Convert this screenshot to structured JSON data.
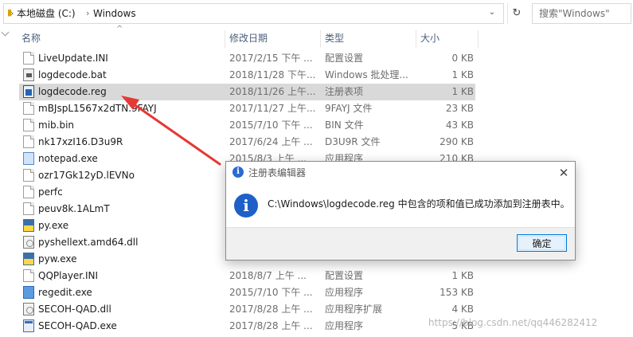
{
  "address_bar": {
    "breadcrumbs": [
      "本地磁盘 (C:)",
      "Windows"
    ],
    "search_placeholder": "搜索\"Windows\""
  },
  "columns": [
    "名称",
    "修改日期",
    "类型",
    "大小"
  ],
  "files": [
    {
      "name": "LiveUpdate.INI",
      "date": "2017/2/15 下午 ...",
      "type": "配置设置",
      "size": "0 KB",
      "icon": "ini-file-icon"
    },
    {
      "name": "logdecode.bat",
      "date": "2018/11/28 下午...",
      "type": "Windows 批处理...",
      "size": "1 KB",
      "icon": "bat-file-icon"
    },
    {
      "name": "logdecode.reg",
      "date": "2018/11/26 上午...",
      "type": "注册表项",
      "size": "1 KB",
      "icon": "reg-file-icon",
      "selected": true
    },
    {
      "name": "mBJspL1567x2dTN.9FAYJ",
      "date": "2017/11/27 上午...",
      "type": "9FAYJ 文件",
      "size": "23 KB",
      "icon": "generic-file-icon"
    },
    {
      "name": "mib.bin",
      "date": "2015/7/10 下午 ...",
      "type": "BIN 文件",
      "size": "43 KB",
      "icon": "generic-file-icon"
    },
    {
      "name": "nk17xzI16.D3u9R",
      "date": "2017/6/24 上午 ...",
      "type": "D3U9R 文件",
      "size": "290 KB",
      "icon": "generic-file-icon"
    },
    {
      "name": "notepad.exe",
      "date": "2015/8/3 上午 ...",
      "type": "应用程序",
      "size": "210 KB",
      "icon": "notepad-icon"
    },
    {
      "name": "ozr17Gk12yD.lEVNo",
      "date": "",
      "type": "",
      "size": "",
      "icon": "generic-file-icon"
    },
    {
      "name": "perfc",
      "date": "",
      "type": "",
      "size": "",
      "icon": "generic-file-icon"
    },
    {
      "name": "peuv8k.1ALmT",
      "date": "",
      "type": "",
      "size": "",
      "icon": "generic-file-icon"
    },
    {
      "name": "py.exe",
      "date": "",
      "type": "",
      "size": "",
      "icon": "python-icon"
    },
    {
      "name": "pyshellext.amd64.dll",
      "date": "",
      "type": "",
      "size": "",
      "icon": "dll-file-icon"
    },
    {
      "name": "pyw.exe",
      "date": "",
      "type": "",
      "size": "",
      "icon": "python-icon"
    },
    {
      "name": "QQPlayer.INI",
      "date": "2018/8/7 上午 ...",
      "type": "配置设置",
      "size": "1 KB",
      "icon": "ini-file-icon"
    },
    {
      "name": "regedit.exe",
      "date": "2015/7/10 下午 ...",
      "type": "应用程序",
      "size": "153 KB",
      "icon": "regedit-icon"
    },
    {
      "name": "SECOH-QAD.dll",
      "date": "2017/8/28 上午 ...",
      "type": "应用程序扩展",
      "size": "4 KB",
      "icon": "dll-file-icon"
    },
    {
      "name": "SECOH-QAD.exe",
      "date": "2017/8/28 上午 ...",
      "type": "应用程序",
      "size": "5 KB",
      "icon": "app-file-icon"
    }
  ],
  "dialog": {
    "title": "注册表编辑器",
    "message": "C:\\Windows\\logdecode.reg 中包含的项和值已成功添加到注册表中。",
    "ok_label": "确定",
    "icon": "info-icon"
  },
  "watermark": "https://blog.csdn.net/qq446282412"
}
